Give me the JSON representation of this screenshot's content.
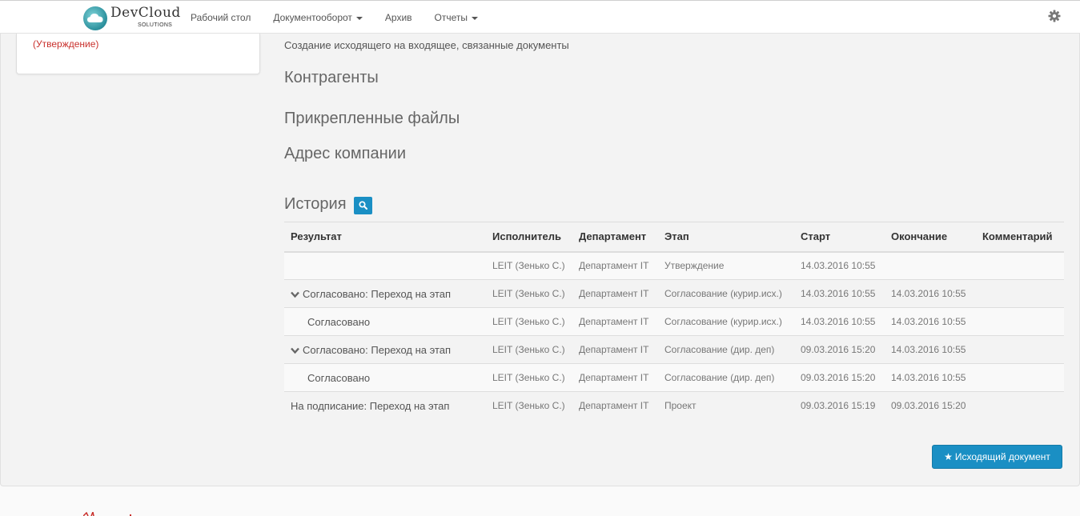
{
  "app": {
    "logo_text": "DevCloud",
    "logo_sub": "SOLUTIONS"
  },
  "nav": {
    "items": [
      {
        "label": "Рабочий стол",
        "has_caret": false
      },
      {
        "label": "Документооборот",
        "has_caret": true
      },
      {
        "label": "Архив",
        "has_caret": false
      },
      {
        "label": "Отчеты",
        "has_caret": true
      }
    ],
    "settings_icon": "gear-icon"
  },
  "left_card": {
    "status": "(Утверждение)"
  },
  "doc": {
    "subtitle": "Создание исходящего на входящее, связанные документы",
    "sections": {
      "counterparties": "Контрагенты",
      "attached_files": "Прикрепленные файлы",
      "company_address": "Адрес компании",
      "history": "История"
    }
  },
  "history": {
    "columns": [
      "Результат",
      "Исполнитель",
      "Департамент",
      "Этап",
      "Старт",
      "Окончание",
      "Комментарий"
    ],
    "rows": [
      {
        "result": "",
        "chevron": false,
        "child": false,
        "executor": "LEIT (Зенько С.)",
        "department": "Департамент IT",
        "stage": "Утверждение",
        "start": "14.03.2016 10:55",
        "end": "",
        "comment": ""
      },
      {
        "result": "Согласовано: Переход на этап",
        "chevron": true,
        "child": false,
        "executor": "LEIT (Зенько С.)",
        "department": "Департамент IT",
        "stage": "Согласование (курир.исх.)",
        "start": "14.03.2016 10:55",
        "end": "14.03.2016 10:55",
        "comment": ""
      },
      {
        "result": "Согласовано",
        "chevron": false,
        "child": true,
        "executor": "LEIT (Зенько С.)",
        "department": "Департамент IT",
        "stage": "Согласование (курир.исх.)",
        "start": "14.03.2016 10:55",
        "end": "14.03.2016 10:55",
        "comment": ""
      },
      {
        "result": "Согласовано: Переход на этап",
        "chevron": true,
        "child": false,
        "executor": "LEIT (Зенько С.)",
        "department": "Департамент IT",
        "stage": "Согласование (дир. деп)",
        "start": "09.03.2016 15:20",
        "end": "14.03.2016 10:55",
        "comment": ""
      },
      {
        "result": "Согласовано",
        "chevron": false,
        "child": true,
        "executor": "LEIT (Зенько С.)",
        "department": "Департамент IT",
        "stage": "Согласование (дир. деп)",
        "start": "09.03.2016 15:20",
        "end": "14.03.2016 10:55",
        "comment": ""
      },
      {
        "result": "На подписание: Переход на этап",
        "chevron": false,
        "child": false,
        "executor": "LEIT (Зенько С.)",
        "department": "Департамент IT",
        "stage": "Проект",
        "start": "09.03.2016 15:19",
        "end": "09.03.2016 15:20",
        "comment": ""
      }
    ]
  },
  "actions": {
    "outgoing_doc_label": "Исходящий документ",
    "outgoing_doc_icon": "star-icon"
  },
  "colors": {
    "accent": "#1a8fc4",
    "status_red": "#c9302c"
  }
}
